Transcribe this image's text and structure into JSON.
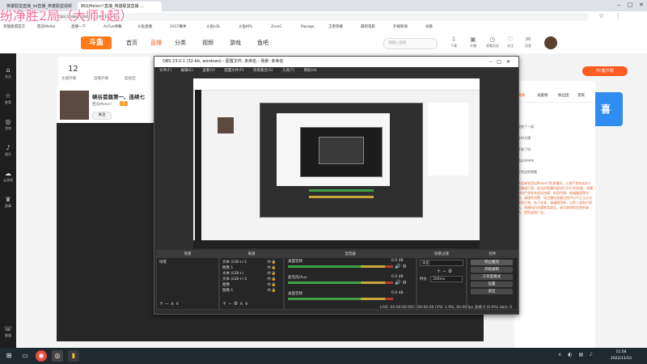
{
  "browser": {
    "tabs": [
      "英雄联盟直播_lol直播_英雄联盟视频",
      "西瓜Melon!!直播_英雄联盟直播 ..."
    ],
    "url": "https://www.douyu.com/103997",
    "bookmarks": [
      "英雄联盟官方",
      "西瓜Melon",
      "直播一下",
      "AcFun弹幕",
      "斗鱼直播",
      "2017赛季",
      "斗鱼LOL",
      "斗鱼KPL",
      "ZeroC",
      "Papago",
      "王者荣耀",
      "最新电影",
      "外媒新闻",
      "谷歌"
    ]
  },
  "overlay": {
    "title": "纷净胜2局（大师1起）"
  },
  "site": {
    "logo": "斗鱼",
    "nav": [
      "首页",
      "直播",
      "分类",
      "视频",
      "游戏",
      "鱼吧"
    ],
    "search_placeholder": "请输入搜索",
    "header_icons": [
      "下载",
      "开播",
      "观看历史",
      "关注",
      "消息",
      "个人中心"
    ],
    "stats": [
      {
        "value": "12",
        "label": "主播开播"
      },
      {
        "value": "",
        "label": "直播开播"
      },
      {
        "value": "",
        "label": "超级回"
      }
    ],
    "room_title": "峡谷首届第一、连续七",
    "streamer_name": "西瓜Melon!",
    "level": "4",
    "follow_label": "关注",
    "pc_button": "PC客户端",
    "rank_tabs": [
      "周榜",
      "贡献榜",
      "粉丝团",
      "贵宾"
    ],
    "notice_text": "欢迎来到西瓜Melon!!的直播间。斗鱼严禁未成年人直播或打赏，依法对直播内容进行24小时巡查。直播间内严禁发布违法违规、低俗色情、吸烟酗酒等内容。请理性消费，如主播在直播过程中以不正当方式诱导打赏、私下交易，请谨慎判断，以防人身财产损失。直播间内如遇售卖商品，请注意辨别信息的真伪，提防虚假广告。",
    "chat_lines": [
      "抢到了一局",
      "在吗主播",
      "开始了吗",
      "西瓜冲冲冲",
      "打完这把就睡",
      "主播好强"
    ]
  },
  "leftbar": [
    "关注",
    "推荐",
    "游戏",
    "娱乐",
    "云游戏",
    "赛事",
    "客服"
  ],
  "obs": {
    "title": "OBS 23.0.1 (32-bit, windows) - 配置文件: 未命名 - 场景: 未命名",
    "menu": [
      "文件(F)",
      "编辑(E)",
      "查看(V)",
      "配置文件(P)",
      "场景集合(S)",
      "工具(T)",
      "帮助(H)"
    ],
    "docks": {
      "scenes": "场景",
      "sources": "来源",
      "mixer": "混音器",
      "transitions": "场景过渡",
      "controls": "控件"
    },
    "scene_item": "场景",
    "sources_items": [
      "文本 (GDI+) 1",
      "图像 1",
      "文本 (GDI+)",
      "文本 (GDI+) 2",
      "图像",
      "图像 1"
    ],
    "mixer": [
      {
        "name": "桌面音频",
        "db": "0.0 dB"
      },
      {
        "name": "麦克风/Aux",
        "db": "0.0 dB"
      },
      {
        "name": "桌面音频",
        "db": "0.0 dB"
      }
    ],
    "transition": "淡出",
    "duration_label": "时长",
    "duration_value": "300ms",
    "controls": [
      "停止推流",
      "开始录制",
      "工作室模式",
      "设置",
      "退出"
    ],
    "status": "LIVE: 00:00:00   REC: 00:00:00   CPU: 1.9%, 60.00 fps   丢帧 0 (0.0%)   kb/s: 0"
  },
  "taskbar": {
    "time": "11:58",
    "date": "2022/11/10"
  }
}
